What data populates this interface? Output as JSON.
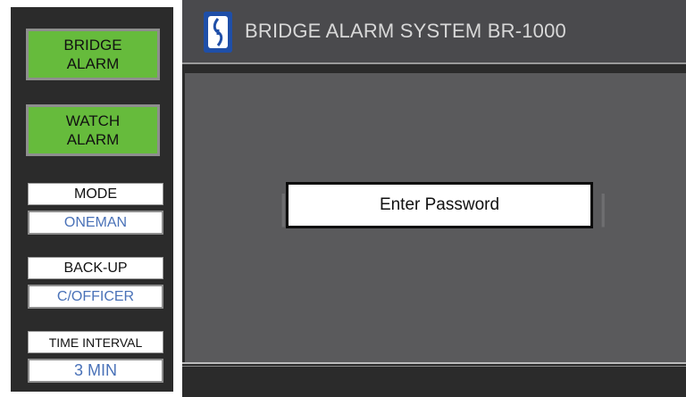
{
  "sidebar": {
    "bridge_alarm_label": "BRIDGE\nALARM",
    "watch_alarm_label": "WATCH\nALARM",
    "mode": {
      "label": "MODE",
      "value": "ONEMAN"
    },
    "backup": {
      "label": "BACK-UP",
      "value": "C/OFFICER"
    },
    "time_interval": {
      "label": "TIME INTERVAL",
      "value": "3 MIN"
    }
  },
  "header": {
    "title": "BRIDGE ALARM SYSTEM BR-1000",
    "logo_icon": "propeller-logo-icon"
  },
  "main": {
    "password_prompt": "Enter Password"
  },
  "colors": {
    "alarm_green": "#66bb3c",
    "value_blue": "#4a72b8",
    "logo_blue": "#1f4fa8",
    "panel_gray": "#5a5a5c",
    "frame_dark": "#2b2b2b"
  }
}
